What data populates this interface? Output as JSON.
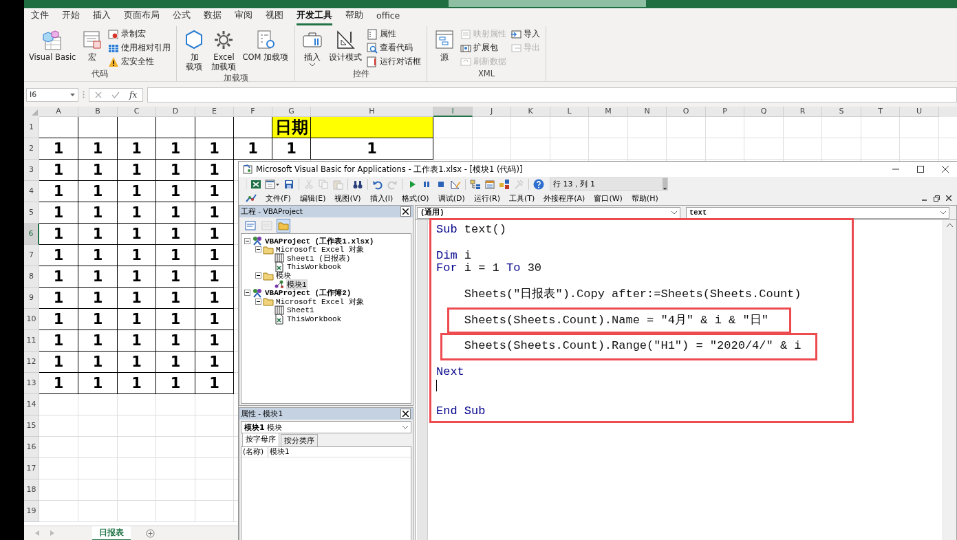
{
  "ribbon": {
    "tabs": [
      {
        "label": "文件",
        "selected": false
      },
      {
        "label": "开始",
        "selected": false
      },
      {
        "label": "插入",
        "selected": false
      },
      {
        "label": "页面布局",
        "selected": false
      },
      {
        "label": "公式",
        "selected": false
      },
      {
        "label": "数据",
        "selected": false
      },
      {
        "label": "审阅",
        "selected": false
      },
      {
        "label": "视图",
        "selected": false
      },
      {
        "label": "开发工具",
        "selected": true
      },
      {
        "label": "帮助",
        "selected": false
      },
      {
        "label": "office",
        "selected": false
      }
    ],
    "groups": [
      {
        "label": "代码",
        "large": [
          {
            "kind": "editor",
            "label": "Visual Basic"
          },
          {
            "kind": "macros",
            "label": "宏"
          }
        ],
        "small_columns": [
          [
            {
              "kind": "record",
              "label": "录制宏",
              "disabled": false
            },
            {
              "kind": "relative",
              "label": "使用相对引用",
              "disabled": false
            },
            {
              "kind": "security",
              "label": "宏安全性",
              "disabled": false
            }
          ]
        ]
      },
      {
        "label": "加载项",
        "large": [
          {
            "kind": "addins",
            "label": "加载项"
          },
          {
            "kind": "exceladdins",
            "label": "Excel 加载项"
          },
          {
            "kind": "comaddins",
            "label": "COM 加载项"
          }
        ]
      },
      {
        "label": "控件",
        "large": [
          {
            "kind": "insert",
            "label": "插入"
          },
          {
            "kind": "design",
            "label": "设计模式"
          }
        ],
        "small_columns": [
          [
            {
              "kind": "properties",
              "label": "属性",
              "disabled": false
            },
            {
              "kind": "viewcode",
              "label": "查看代码",
              "disabled": false
            },
            {
              "kind": "dialog",
              "label": "运行对话框",
              "disabled": false
            }
          ]
        ]
      },
      {
        "label": "XML",
        "large": [
          {
            "kind": "source",
            "label": "源"
          }
        ],
        "small_columns": [
          [
            {
              "kind": "mapping",
              "label": "映射属性",
              "disabled": true
            },
            {
              "kind": "expansion",
              "label": "扩展包",
              "disabled": false
            },
            {
              "kind": "refresh",
              "label": "刷新数据",
              "disabled": true
            }
          ],
          [
            {
              "kind": "import",
              "label": "导入",
              "disabled": false
            },
            {
              "kind": "export",
              "label": "导出",
              "disabled": true
            }
          ]
        ]
      }
    ]
  },
  "formula_bar": {
    "name_box": "I6",
    "function_label": "fx"
  },
  "sheet": {
    "columns": [
      {
        "label": "A",
        "selected": false
      },
      {
        "label": "B",
        "selected": false
      },
      {
        "label": "C",
        "selected": false
      },
      {
        "label": "D",
        "selected": false
      },
      {
        "label": "E",
        "selected": false
      },
      {
        "label": "F",
        "selected": false
      },
      {
        "label": "G",
        "selected": false
      },
      {
        "label": "H",
        "selected": false
      },
      {
        "label": "I",
        "selected": true
      },
      {
        "label": "J",
        "selected": false
      },
      {
        "label": "K",
        "selected": false
      },
      {
        "label": "L",
        "selected": false
      },
      {
        "label": "M",
        "selected": false
      },
      {
        "label": "N",
        "selected": false
      },
      {
        "label": "O",
        "selected": false
      },
      {
        "label": "P",
        "selected": false
      },
      {
        "label": "Q",
        "selected": false
      },
      {
        "label": "R",
        "selected": false
      },
      {
        "label": "S",
        "selected": false
      },
      {
        "label": "T",
        "selected": false
      },
      {
        "label": "U",
        "selected": false
      }
    ],
    "rows": [
      {
        "header": "1",
        "selected": false,
        "cells": [
          {
            "highlighted": false
          },
          {
            "highlighted": false
          },
          {
            "highlighted": false
          },
          {
            "highlighted": false
          },
          {
            "highlighted": false
          },
          {
            "highlighted": false
          },
          {
            "text": "日期",
            "highlighted": true
          },
          {
            "highlighted": true
          }
        ]
      },
      {
        "header": "2",
        "selected": false,
        "cells": [
          {
            "text": "1",
            "highlighted": false
          },
          {
            "text": "1",
            "highlighted": false
          },
          {
            "text": "1",
            "highlighted": false
          },
          {
            "text": "1",
            "highlighted": false
          },
          {
            "text": "1",
            "highlighted": false
          },
          {
            "text": "1",
            "highlighted": false
          },
          {
            "text": "1",
            "highlighted": false
          },
          {
            "text": "1",
            "highlighted": false
          }
        ]
      },
      {
        "header": "3",
        "selected": false,
        "cells": [
          {
            "text": "1",
            "highlighted": false
          },
          {
            "text": "1",
            "highlighted": false
          },
          {
            "text": "1",
            "highlighted": false
          },
          {
            "text": "1",
            "highlighted": false
          },
          {
            "text": "1",
            "highlighted": false
          }
        ]
      },
      {
        "header": "4",
        "selected": false,
        "cells": [
          {
            "text": "1",
            "highlighted": false
          },
          {
            "text": "1",
            "highlighted": false
          },
          {
            "text": "1",
            "highlighted": false
          },
          {
            "text": "1",
            "highlighted": false
          },
          {
            "text": "1",
            "highlighted": false
          }
        ]
      },
      {
        "header": "5",
        "selected": false,
        "cells": [
          {
            "text": "1",
            "highlighted": false
          },
          {
            "text": "1",
            "highlighted": false
          },
          {
            "text": "1",
            "highlighted": false
          },
          {
            "text": "1",
            "highlighted": false
          },
          {
            "text": "1",
            "highlighted": false
          }
        ]
      },
      {
        "header": "6",
        "selected": true,
        "cells": [
          {
            "text": "1",
            "highlighted": false
          },
          {
            "text": "1",
            "highlighted": false
          },
          {
            "text": "1",
            "highlighted": false
          },
          {
            "text": "1",
            "highlighted": false
          },
          {
            "text": "1",
            "highlighted": false
          }
        ]
      },
      {
        "header": "7",
        "selected": false,
        "cells": [
          {
            "text": "1",
            "highlighted": false
          },
          {
            "text": "1",
            "highlighted": false
          },
          {
            "text": "1",
            "highlighted": false
          },
          {
            "text": "1",
            "highlighted": false
          },
          {
            "text": "1",
            "highlighted": false
          }
        ]
      },
      {
        "header": "8",
        "selected": false,
        "cells": [
          {
            "text": "1",
            "highlighted": false
          },
          {
            "text": "1",
            "highlighted": false
          },
          {
            "text": "1",
            "highlighted": false
          },
          {
            "text": "1",
            "highlighted": false
          },
          {
            "text": "1",
            "highlighted": false
          }
        ]
      },
      {
        "header": "9",
        "selected": false,
        "cells": [
          {
            "text": "1",
            "highlighted": false
          },
          {
            "text": "1",
            "highlighted": false
          },
          {
            "text": "1",
            "highlighted": false
          },
          {
            "text": "1",
            "highlighted": false
          },
          {
            "text": "1",
            "highlighted": false
          }
        ]
      },
      {
        "header": "10",
        "selected": false,
        "cells": [
          {
            "text": "1",
            "highlighted": false
          },
          {
            "text": "1",
            "highlighted": false
          },
          {
            "text": "1",
            "highlighted": false
          },
          {
            "text": "1",
            "highlighted": false
          },
          {
            "text": "1",
            "highlighted": false
          }
        ]
      },
      {
        "header": "11",
        "selected": false,
        "cells": [
          {
            "text": "1",
            "highlighted": false
          },
          {
            "text": "1",
            "highlighted": false
          },
          {
            "text": "1",
            "highlighted": false
          },
          {
            "text": "1",
            "highlighted": false
          },
          {
            "text": "1",
            "highlighted": false
          }
        ]
      },
      {
        "header": "12",
        "selected": false,
        "cells": [
          {
            "text": "1",
            "highlighted": false
          },
          {
            "text": "1",
            "highlighted": false
          },
          {
            "text": "1",
            "highlighted": false
          },
          {
            "text": "1",
            "highlighted": false
          },
          {
            "text": "1",
            "highlighted": false
          }
        ]
      },
      {
        "header": "13",
        "selected": false,
        "cells": [
          {
            "text": "1",
            "highlighted": false
          },
          {
            "text": "1",
            "highlighted": false
          },
          {
            "text": "1",
            "highlighted": false
          },
          {
            "text": "1",
            "highlighted": false
          },
          {
            "text": "1",
            "highlighted": false
          }
        ]
      },
      {
        "header": "14",
        "selected": false
      },
      {
        "header": "15",
        "selected": false
      },
      {
        "header": "16",
        "selected": false
      },
      {
        "header": "17",
        "selected": false
      },
      {
        "header": "18",
        "selected": false
      },
      {
        "header": "19",
        "selected": false
      }
    ],
    "tabs": [
      {
        "label": "日报表",
        "selected": true
      }
    ]
  },
  "vba_editor": {
    "title": "Microsoft Visual Basic for Applications - 工作表1.xlsx - [模块1 (代码)]",
    "toolbar": [
      {
        "kind": "excel",
        "disabled": false
      },
      {
        "kind": "form",
        "disabled": false
      },
      {
        "kind": "save",
        "disabled": false
      },
      {
        "kind": "cut",
        "disabled": true
      },
      {
        "kind": "copy",
        "disabled": true
      },
      {
        "kind": "paste",
        "disabled": true
      },
      {
        "kind": "find",
        "disabled": false
      },
      {
        "kind": "undo",
        "disabled": false
      },
      {
        "kind": "redo",
        "disabled": true
      },
      {
        "kind": "run",
        "disabled": false
      },
      {
        "kind": "pause",
        "disabled": false
      },
      {
        "kind": "stop",
        "disabled": false
      },
      {
        "kind": "design",
        "disabled": false
      },
      {
        "kind": "project",
        "disabled": false
      },
      {
        "kind": "properties",
        "disabled": false
      },
      {
        "kind": "browser",
        "disabled": false
      },
      {
        "kind": "toolbox",
        "disabled": true
      },
      {
        "kind": "help",
        "disabled": false
      }
    ],
    "position": "行 13，列 1",
    "menu": [
      "文件(F)",
      "编辑(E)",
      "视图(V)",
      "插入(I)",
      "格式(O)",
      "调试(D)",
      "运行(R)",
      "工具(T)",
      "外接程序(A)",
      "窗口(W)",
      "帮助(H)"
    ],
    "project": {
      "title": "工程 - VBAProject",
      "toolbar": [
        {
          "kind": "code",
          "pressed": false,
          "disabled": false
        },
        {
          "kind": "object",
          "pressed": false,
          "disabled": true
        },
        {
          "kind": "folders",
          "pressed": true,
          "disabled": false
        }
      ],
      "tree": [
        {
          "kind": "project",
          "label": "VBAProject (工作表1.xlsx)",
          "expanded": true,
          "selected": false,
          "children": [
            {
              "kind": "folder",
              "label": "Microsoft Excel 对象",
              "expanded": true,
              "selected": false,
              "children": [
                {
                  "kind": "sheet",
                  "label": "Sheet1 (日报表)",
                  "selected": false
                },
                {
                  "kind": "workbook",
                  "label": "ThisWorkbook",
                  "selected": false
                }
              ]
            },
            {
              "kind": "folder",
              "label": "模块",
              "expanded": true,
              "selected": false,
              "children": [
                {
                  "kind": "module",
                  "label": "模块1",
                  "selected": true
                }
              ]
            }
          ]
        },
        {
          "kind": "project",
          "label": "VBAProject (工作簿2)",
          "expanded": true,
          "selected": false,
          "children": [
            {
              "kind": "folder",
              "label": "Microsoft Excel 对象",
              "expanded": true,
              "selected": false,
              "children": [
                {
                  "kind": "sheet",
                  "label": "Sheet1",
                  "selected": false
                },
                {
                  "kind": "workbook",
                  "label": "ThisWorkbook",
                  "selected": false
                }
              ]
            }
          ]
        }
      ]
    },
    "properties": {
      "title": "属性 - 模块1",
      "object": "**模块1** 模块",
      "tabs": [
        {
          "label": "按字母序",
          "selected": true
        },
        {
          "label": "按分类序",
          "selected": false
        }
      ],
      "rows": [
        {
          "name": "(名称)",
          "value": "模块1"
        }
      ]
    },
    "code": {
      "object": "(通用)",
      "procedure": "text",
      "lines": [
        {
          "kind": "code",
          "tokens": [
            {
              "kind": "keyword",
              "text": "Sub"
            },
            {
              "kind": "plain",
              "text": " text()"
            }
          ]
        },
        {
          "kind": "blank"
        },
        {
          "kind": "code",
          "tokens": [
            {
              "kind": "keyword",
              "text": "Dim"
            },
            {
              "kind": "plain",
              "text": " i"
            }
          ]
        },
        {
          "kind": "code",
          "tokens": [
            {
              "kind": "keyword",
              "text": "For"
            },
            {
              "kind": "plain",
              "text": " i = 1 "
            },
            {
              "kind": "keyword",
              "text": "To"
            },
            {
              "kind": "plain",
              "text": " 30"
            }
          ]
        },
        {
          "kind": "blank"
        },
        {
          "kind": "code",
          "tokens": [
            {
              "kind": "plain",
              "text": "    Sheets(\"日报表\").Copy after:=Sheets(Sheets.Count)"
            }
          ]
        },
        {
          "kind": "blank"
        },
        {
          "kind": "code",
          "tokens": [
            {
              "kind": "plain",
              "text": "    Sheets(Sheets.Count).Name = \"4月\" & i & \"日\""
            }
          ]
        },
        {
          "kind": "blank"
        },
        {
          "kind": "code",
          "tokens": [
            {
              "kind": "plain",
              "text": "    Sheets(Sheets.Count).Range(\"H1\") = \"2020/4/\" & i"
            }
          ]
        },
        {
          "kind": "blank"
        },
        {
          "kind": "code",
          "tokens": [
            {
              "kind": "keyword",
              "text": "Next"
            }
          ]
        },
        {
          "kind": "cursor"
        },
        {
          "kind": "blank"
        },
        {
          "kind": "code",
          "tokens": [
            {
              "kind": "keyword",
              "text": "End Sub"
            }
          ]
        }
      ]
    }
  }
}
